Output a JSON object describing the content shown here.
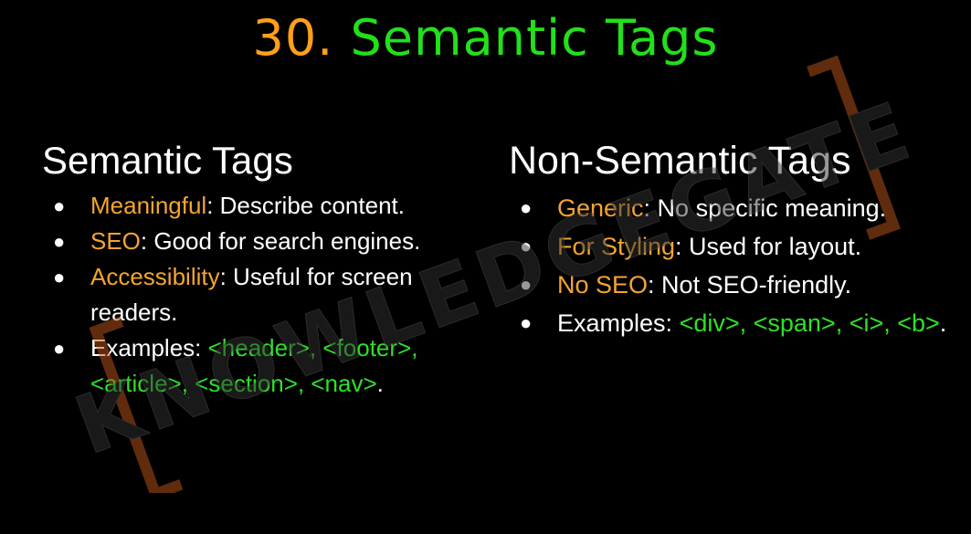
{
  "title": {
    "number": "30.",
    "text": "Semantic Tags"
  },
  "left": {
    "heading": "Semantic Tags",
    "items": [
      {
        "term": "Meaningful",
        "rest": ": Describe content."
      },
      {
        "term": "SEO",
        "rest": ": Good for search engines."
      },
      {
        "term": "Accessibility",
        "rest": ": Useful for screen readers."
      },
      {
        "prefix": "Examples: ",
        "code": "<header>, <footer>, <article>, <section>, <nav>",
        "suffix": "."
      }
    ]
  },
  "right": {
    "heading": "Non-Semantic Tags",
    "items": [
      {
        "term": "Generic",
        "rest": ": No specific meaning."
      },
      {
        "term": "For Styling",
        "rest": ": Used for layout."
      },
      {
        "term": "No SEO",
        "rest": ": Not SEO-friendly."
      },
      {
        "prefix": "Examples: ",
        "code": "<div>, <span>, <i>, <b>",
        "suffix": "."
      }
    ]
  },
  "watermark": {
    "text": "KNOWLEDGEGATE"
  },
  "colors": {
    "accent_orange": "#f5a431",
    "code_green": "#2ee02a",
    "title_green": "#22e01a",
    "background": "#000000"
  },
  "icons": {
    "bullet": "bullet-dot-icon"
  }
}
